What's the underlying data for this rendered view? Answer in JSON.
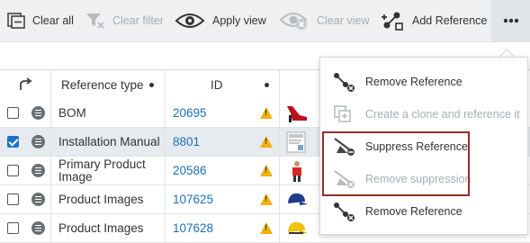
{
  "toolbar": {
    "clear_all": "Clear all",
    "clear_filter": "Clear filter",
    "apply_view": "Apply view",
    "clear_view": "Clear view",
    "add_reference": "Add Reference",
    "more_icon": "more-horizontal-icon"
  },
  "table": {
    "headers": {
      "reference_type": "Reference type",
      "id": "ID"
    },
    "rows": [
      {
        "checked": false,
        "type": "BOM",
        "id": "20695",
        "thumb": "red-shoe"
      },
      {
        "checked": true,
        "type": "Installation Manual",
        "id": "8801",
        "thumb": "document"
      },
      {
        "checked": false,
        "type": "Primary Product Image",
        "id": "20586",
        "thumb": "person"
      },
      {
        "checked": false,
        "type": "Product Images",
        "id": "107625",
        "thumb": "blue-cap"
      },
      {
        "checked": false,
        "type": "Product Images",
        "id": "107628",
        "thumb": "yellow-cap"
      }
    ]
  },
  "menu": {
    "items": [
      {
        "label": "Remove Reference",
        "disabled": false,
        "icon": "remove-reference-icon"
      },
      {
        "label": "Create a clone and reference it",
        "disabled": true,
        "icon": "clone-icon"
      },
      {
        "label": "Suppress Reference",
        "disabled": false,
        "icon": "suppress-reference-icon"
      },
      {
        "label": "Remove suppression",
        "disabled": true,
        "icon": "remove-suppression-icon"
      },
      {
        "label": "Remove Reference",
        "disabled": false,
        "icon": "remove-reference-icon"
      }
    ]
  },
  "colors": {
    "accent": "#1a73c8",
    "link": "#1a6fb8",
    "warning": "#f2b10c",
    "highlight": "#9a2a2a"
  }
}
